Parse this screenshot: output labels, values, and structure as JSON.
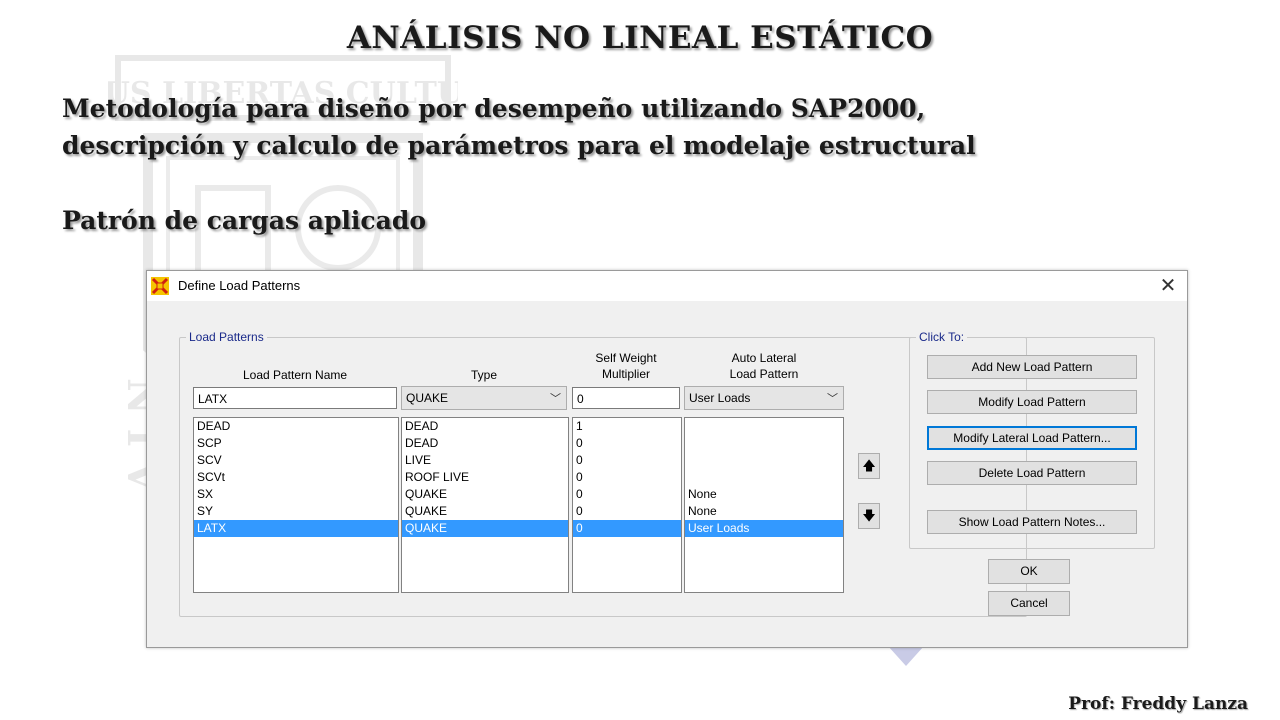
{
  "slide": {
    "title": "ANÁLISIS NO LINEAL ESTÁTICO",
    "subtitle_line1": "Metodología para diseño por desempeño utilizando SAP2000,",
    "subtitle_line2": "descripción y calculo de parámetros para el modelaje estructural",
    "section_title": "Patrón de cargas aplicado",
    "author": "Prof: Freddy Lanza",
    "watermark_text": "DEUS LIBERTAS CULTURA"
  },
  "dialog": {
    "title": "Define Load Patterns",
    "close_glyph": "✕",
    "load_patterns_group": "Load Patterns",
    "click_to_group": "Click To:",
    "headers": {
      "name": "Load Pattern Name",
      "type": "Type",
      "self_weight_1": "Self Weight",
      "self_weight_2": "Multiplier",
      "auto_lateral_1": "Auto Lateral",
      "auto_lateral_2": "Load Pattern"
    },
    "edit": {
      "name": "LATX",
      "type": "QUAKE",
      "self_weight": "0",
      "auto_lateral": "User Loads"
    },
    "rows": [
      {
        "name": "DEAD",
        "type": "DEAD",
        "self_weight": "1",
        "auto_lateral": ""
      },
      {
        "name": "SCP",
        "type": "DEAD",
        "self_weight": "0",
        "auto_lateral": ""
      },
      {
        "name": "SCV",
        "type": "LIVE",
        "self_weight": "0",
        "auto_lateral": ""
      },
      {
        "name": "SCVt",
        "type": "ROOF LIVE",
        "self_weight": "0",
        "auto_lateral": ""
      },
      {
        "name": "SX",
        "type": "QUAKE",
        "self_weight": "0",
        "auto_lateral": "None"
      },
      {
        "name": "SY",
        "type": "QUAKE",
        "self_weight": "0",
        "auto_lateral": "None"
      },
      {
        "name": "LATX",
        "type": "QUAKE",
        "self_weight": "0",
        "auto_lateral": "User Loads"
      }
    ],
    "selected_row": "LATX",
    "buttons": {
      "add": "Add New Load Pattern",
      "modify": "Modify Load Pattern",
      "modify_lateral": "Modify Lateral Load Pattern...",
      "delete": "Delete Load Pattern",
      "notes": "Show Load Pattern Notes...",
      "ok": "OK",
      "cancel": "Cancel"
    },
    "move_up_icon": "up-arrow-icon",
    "move_down_icon": "down-arrow-icon",
    "accent_color": "#3399ff",
    "group_label_color": "#1a2a8a"
  }
}
